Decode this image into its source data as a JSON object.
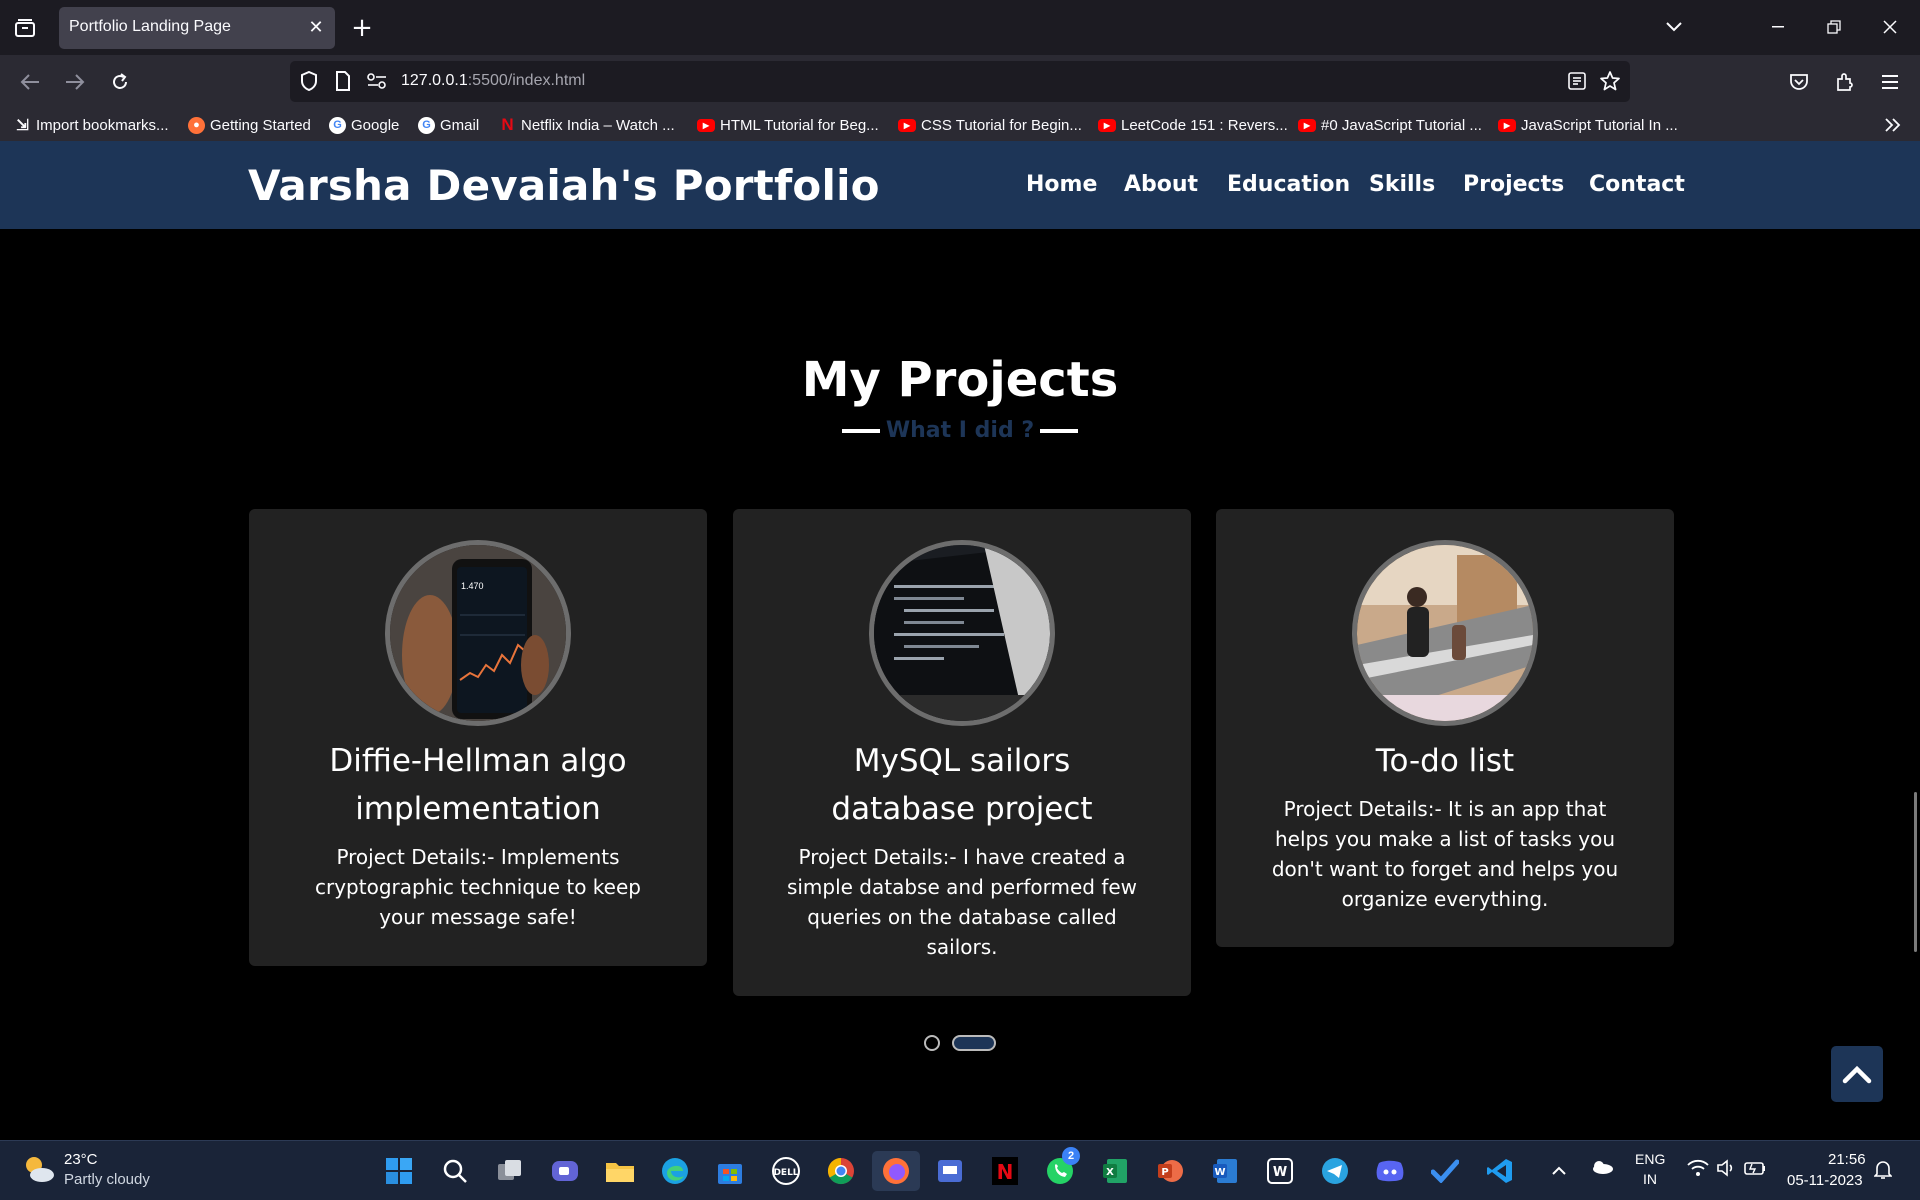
{
  "browser": {
    "tab_title": "Portfolio Landing Page",
    "url_host": "127.0.0.1",
    "url_rest": ":5500/index.html",
    "bookmarks": [
      {
        "label": "Import bookmarks...",
        "icon": "import-icon"
      },
      {
        "label": "Getting Started",
        "icon": "firefox-icon"
      },
      {
        "label": "Google",
        "icon": "google-icon"
      },
      {
        "label": "Gmail",
        "icon": "google-icon"
      },
      {
        "label": "Netflix India – Watch ...",
        "icon": "netflix-icon"
      },
      {
        "label": "HTML Tutorial for Beg...",
        "icon": "youtube-icon"
      },
      {
        "label": "CSS Tutorial for Begin...",
        "icon": "youtube-icon"
      },
      {
        "label": "LeetCode 151 : Revers...",
        "icon": "youtube-icon"
      },
      {
        "label": "#0 JavaScript Tutorial ...",
        "icon": "youtube-icon"
      },
      {
        "label": "JavaScript Tutorial In ...",
        "icon": "youtube-icon"
      }
    ]
  },
  "site": {
    "title": "Varsha Devaiah's Portfolio",
    "menu": [
      "Home",
      "About",
      "Education",
      "Skills",
      "Projects",
      "Contact"
    ],
    "header_color": "#1d3557"
  },
  "projects": {
    "heading": "My Projects",
    "subtitle": "What I did ?",
    "cards": [
      {
        "title_lines": [
          "Diffie-Hellman algo",
          "implementation"
        ],
        "details": [
          "Project Details:- Implements",
          "cryptographic technique to keep",
          "your message safe!"
        ],
        "image": "phone-stock-chart"
      },
      {
        "title_lines": [
          "MySQL sailors",
          "database project"
        ],
        "details": [
          "Project Details:- I have created a",
          "simple databse and performed few",
          "queries on the database called",
          "sailors."
        ],
        "image": "code-monitor"
      },
      {
        "title_lines": [
          "To-do list"
        ],
        "details": [
          "Project Details:- It is an app that",
          "helps you make a list of tasks you",
          "don't want to forget and helps you",
          "organize everything."
        ],
        "image": "mall-escalator"
      }
    ],
    "carousel": {
      "pages": 2,
      "active_index": 1
    }
  },
  "taskbar": {
    "weather_temp": "23°C",
    "weather_desc": "Partly cloudy",
    "lang_top": "ENG",
    "lang_bottom": "IN",
    "time": "21:56",
    "date": "05-11-2023",
    "whatsapp_badge": "2"
  }
}
